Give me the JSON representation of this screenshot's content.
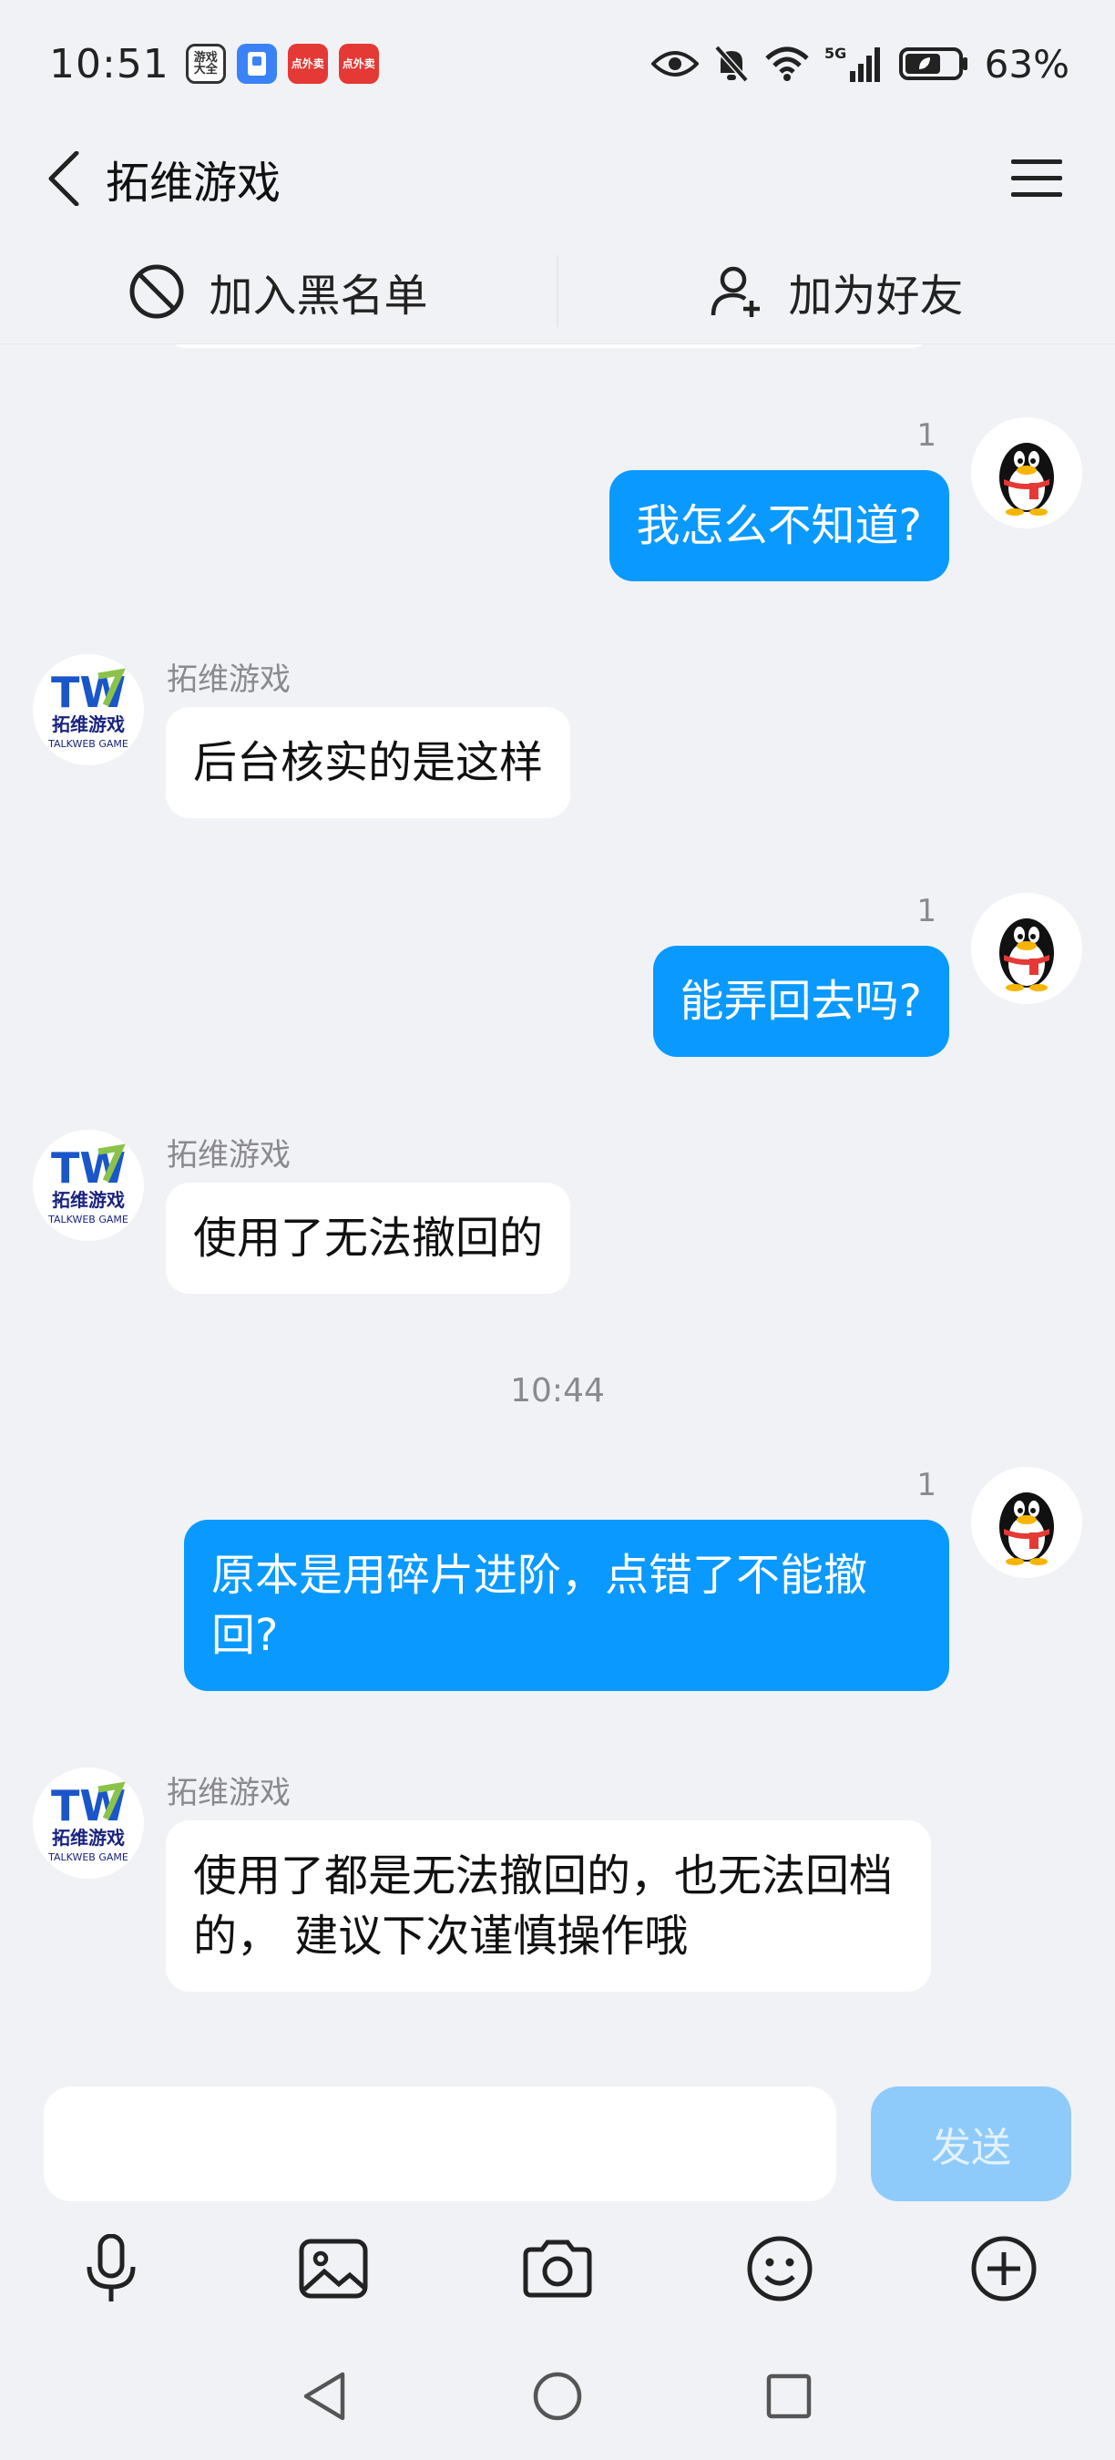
{
  "status_bar": {
    "time": "10:51",
    "apps": [
      {
        "icon": "game-center-icon",
        "label": "游戏大全"
      },
      {
        "icon": "blue-app-icon",
        "label": ""
      },
      {
        "icon": "food-delivery-icon",
        "label": "点外卖"
      },
      {
        "icon": "food-delivery-icon",
        "label": "点外卖"
      }
    ],
    "network": "5G",
    "battery": "63%",
    "icons": [
      "eye-icon",
      "bell-off-icon",
      "wifi-icon",
      "signal-icon",
      "battery-icon"
    ]
  },
  "header": {
    "title": "拓维游戏",
    "back_icon": "chevron-left-icon",
    "menu_icon": "hamburger-menu-icon"
  },
  "actions": {
    "blacklist": "加入黑名单",
    "add_friend": "加为好友"
  },
  "messages": [
    {
      "from": "me",
      "read": "1",
      "text": "我怎么不知道?"
    },
    {
      "from": "other",
      "sender": "拓维游戏",
      "text": "后台核实的是这样"
    },
    {
      "from": "me",
      "read": "1",
      "text": "能弄回去吗?"
    },
    {
      "from": "other",
      "sender": "拓维游戏",
      "text": "使用了无法撤回的"
    },
    {
      "type": "time",
      "text": "10:44"
    },
    {
      "from": "me",
      "read": "1",
      "text": "原本是用碎片进阶，点错了不能撤回?"
    },
    {
      "from": "other",
      "sender": "拓维游戏",
      "text": "使用了都是无法撤回的，也无法回档的， 建议下次谨慎操作哦"
    }
  ],
  "avatar_logo": {
    "mark": "TW",
    "name": "拓维游戏",
    "sub": "TALKWEB GAME"
  },
  "input": {
    "placeholder": "",
    "value": ""
  },
  "send_label": "发送",
  "tools": [
    "microphone-icon",
    "image-icon",
    "camera-icon",
    "emoji-icon",
    "plus-circle-icon"
  ],
  "nav": [
    "back-triangle-icon",
    "home-circle-icon",
    "recents-square-icon"
  ],
  "colors": {
    "outgoing_bubble": "#0a99ff",
    "send_disabled": "#8fcbfa",
    "background": "#f1f2f6"
  }
}
